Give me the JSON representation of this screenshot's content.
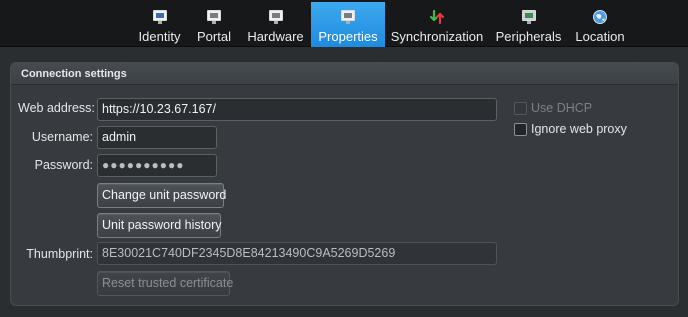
{
  "tabs": [
    {
      "label": "Identity",
      "icon": "identity-icon"
    },
    {
      "label": "Portal",
      "icon": "portal-icon"
    },
    {
      "label": "Hardware",
      "icon": "hardware-icon"
    },
    {
      "label": "Properties",
      "icon": "properties-icon",
      "active": true
    },
    {
      "label": "Synchronization",
      "icon": "synchronization-icon"
    },
    {
      "label": "Peripherals",
      "icon": "peripherals-icon"
    },
    {
      "label": "Location",
      "icon": "location-icon"
    }
  ],
  "section": {
    "title": "Connection settings"
  },
  "form": {
    "web_address_label": "Web address:",
    "web_address_value": "https://10.23.67.167/",
    "username_label": "Username:",
    "username_value": "admin",
    "password_label": "Password:",
    "password_value": "●●●●●●●●●●",
    "change_password_label": "Change unit password",
    "password_history_label": "Unit password history",
    "thumbprint_label": "Thumbprint:",
    "thumbprint_value": "8E30021C740DF2345D8E84213490C9A5269D5269",
    "reset_certificate_label": "Reset trusted certificate"
  },
  "options": {
    "use_dhcp_label": "Use DHCP",
    "use_dhcp_checked": false,
    "use_dhcp_enabled": false,
    "ignore_proxy_label": "Ignore web proxy",
    "ignore_proxy_checked": false
  },
  "colors": {
    "active_tab": "#1d8be0",
    "background": "#2b2e31",
    "tabbar": "#16181a"
  }
}
